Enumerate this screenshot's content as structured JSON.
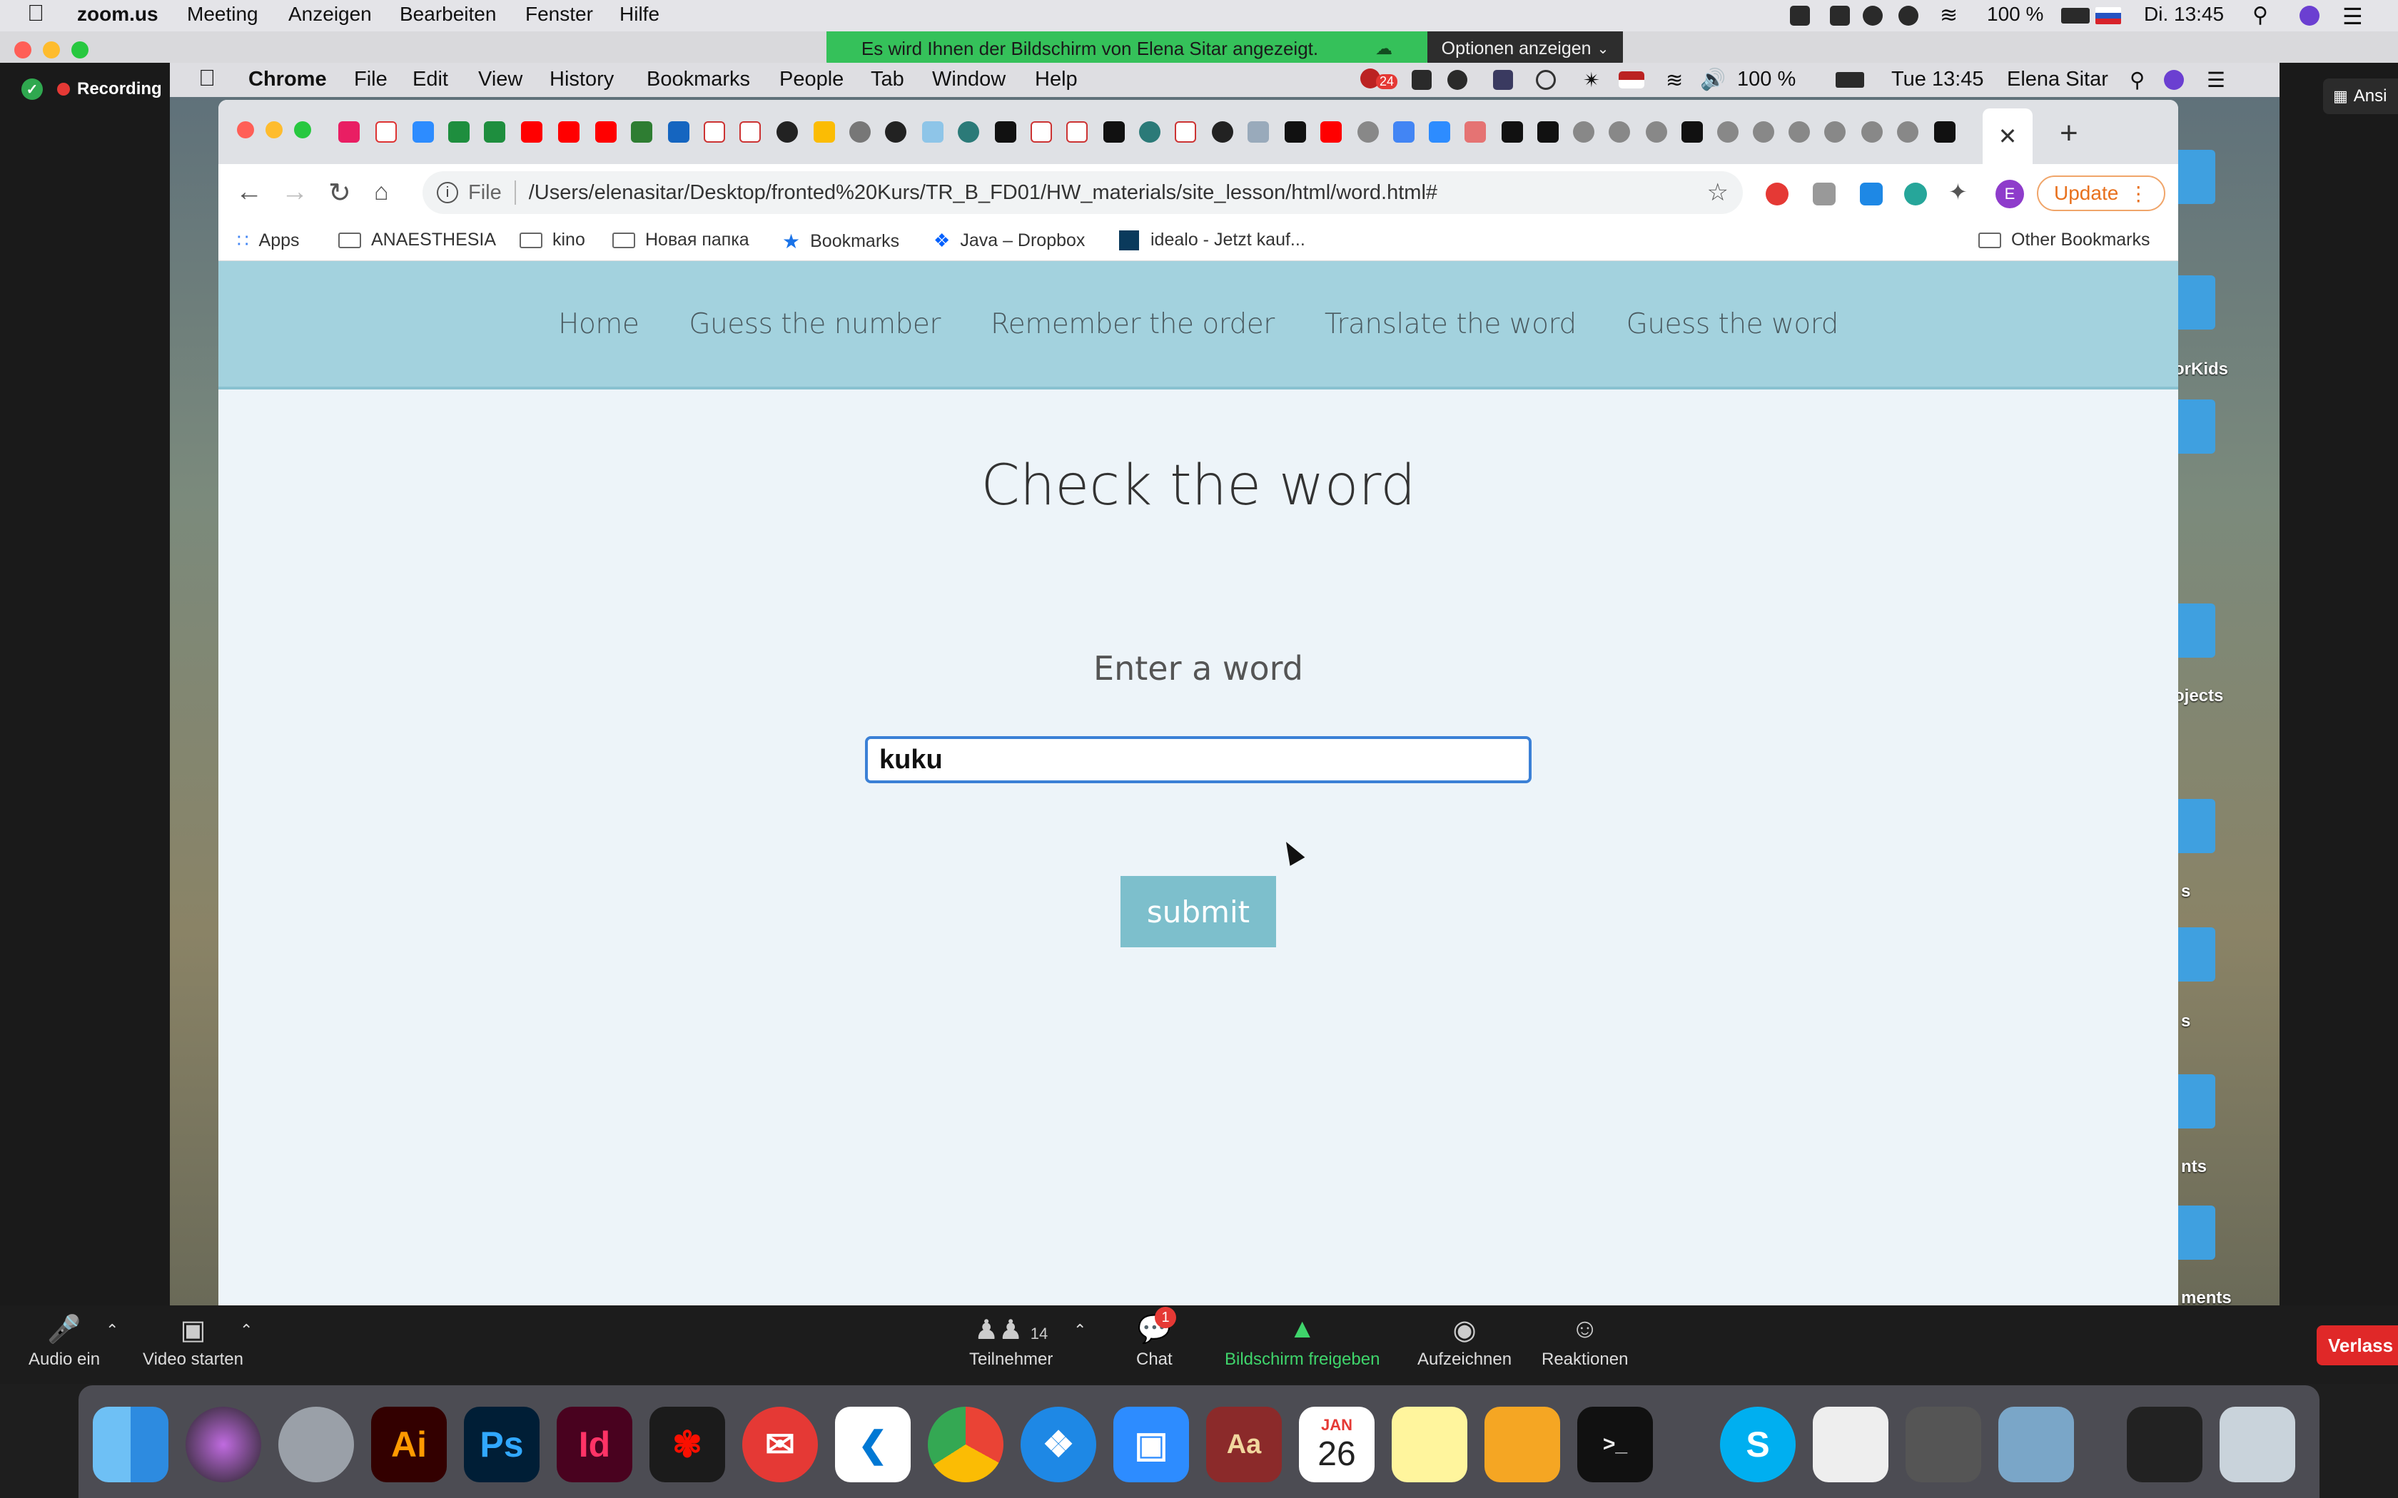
{
  "host_menubar": {
    "app_name": "zoom.us",
    "menus": [
      "Meeting",
      "Anzeigen",
      "Bearbeiten",
      "Fenster",
      "Hilfe"
    ],
    "battery": "100 %",
    "clock": "Di. 13:45"
  },
  "zoom": {
    "share_banner": "Es wird Ihnen der Bildschirm von Elena Sitar angezeigt.",
    "share_options": "Optionen anzeigen",
    "recording": "Recording",
    "side_button": "Ansi",
    "desktop_labels": [
      "orKids",
      "ojects",
      "s",
      "s",
      "nts",
      "ments"
    ],
    "controls": {
      "audio": "Audio ein",
      "video": "Video starten",
      "participants": "Teilnehmer",
      "participants_count": "14",
      "chat": "Chat",
      "chat_badge": "1",
      "share": "Bildschirm freigeben",
      "record": "Aufzeichnen",
      "reactions": "Reaktionen",
      "leave": "Verlass"
    }
  },
  "shared_menubar": {
    "app_name": "Chrome",
    "menus": [
      "File",
      "Edit",
      "View",
      "History",
      "Bookmarks",
      "People",
      "Tab",
      "Window",
      "Help"
    ],
    "battery": "100 %",
    "clock": "Tue 13:45",
    "user": "Elena Sitar",
    "badge": "24"
  },
  "browser": {
    "url_scheme": "File",
    "url": "/Users/elenasitar/Desktop/fronted%20Kurs/TR_B_FD01/HW_materials/site_lesson/html/word.html#",
    "update_label": "Update",
    "profile_initial": "E",
    "bookmarks": [
      "Apps",
      "ANAESTHESIA",
      "kino",
      "Новая папка",
      "Bookmarks",
      "Java – Dropbox",
      "idealo - Jetzt kauf..."
    ],
    "other_bookmarks": "Other Bookmarks"
  },
  "site": {
    "nav": [
      "Home",
      "Guess the number",
      "Remember the order",
      "Translate the word",
      "Guess the word"
    ],
    "title": "Check the word",
    "input_label": "Enter a word",
    "input_value": "kuku",
    "submit": "submit"
  },
  "dock": {
    "calendar_month": "JAN",
    "calendar_day": "26"
  },
  "colors": {
    "nav_bg": "#a3d2de",
    "page_bg": "#edf4f9",
    "submit_bg": "#7dbfcc",
    "input_focus": "#3b80d6",
    "zoom_green": "#35c15a"
  }
}
